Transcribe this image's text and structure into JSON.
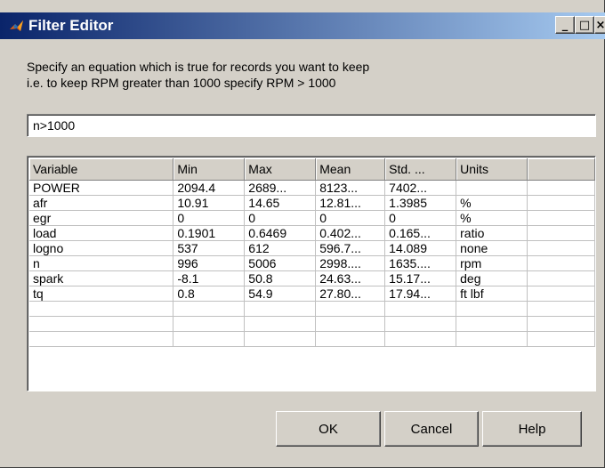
{
  "window": {
    "title": "Filter Editor"
  },
  "prompt": {
    "line1": "Specify an equation which is true for records you want to keep",
    "line2": "i.e. to keep RPM greater than 1000 specify RPM > 1000"
  },
  "equation": {
    "value": "n>1000"
  },
  "table": {
    "columns": [
      "Variable",
      "Min",
      "Max",
      "Mean",
      "Std. ...",
      "Units",
      ""
    ],
    "rows": [
      [
        "POWER",
        "2094.4",
        "2689...",
        "8123...",
        "7402...",
        ""
      ],
      [
        "afr",
        "10.91",
        "14.65",
        "12.81...",
        "1.3985",
        "%"
      ],
      [
        "egr",
        "0",
        "0",
        "0",
        "0",
        "%"
      ],
      [
        "load",
        "0.1901",
        "0.6469",
        "0.402...",
        "0.165...",
        "ratio"
      ],
      [
        "logno",
        "537",
        "612",
        "596.7...",
        "14.089",
        "none"
      ],
      [
        "n",
        "996",
        "5006",
        "2998....",
        "1635....",
        "rpm"
      ],
      [
        "spark",
        "-8.1",
        "50.8",
        "24.63...",
        "15.17...",
        "deg"
      ],
      [
        "tq",
        "0.8",
        "54.9",
        "27.80...",
        "17.94...",
        "ft lbf"
      ]
    ],
    "empty_rows": 3
  },
  "buttons": {
    "ok": "OK",
    "cancel": "Cancel",
    "help": "Help"
  },
  "icons": {
    "app": "matlab-icon",
    "minimize": "minimize-icon",
    "maximize": "maximize-icon",
    "close": "close-icon"
  },
  "colors": {
    "title_start": "#0a246a",
    "title_end": "#a6caf0",
    "face": "#d4d0c8"
  }
}
